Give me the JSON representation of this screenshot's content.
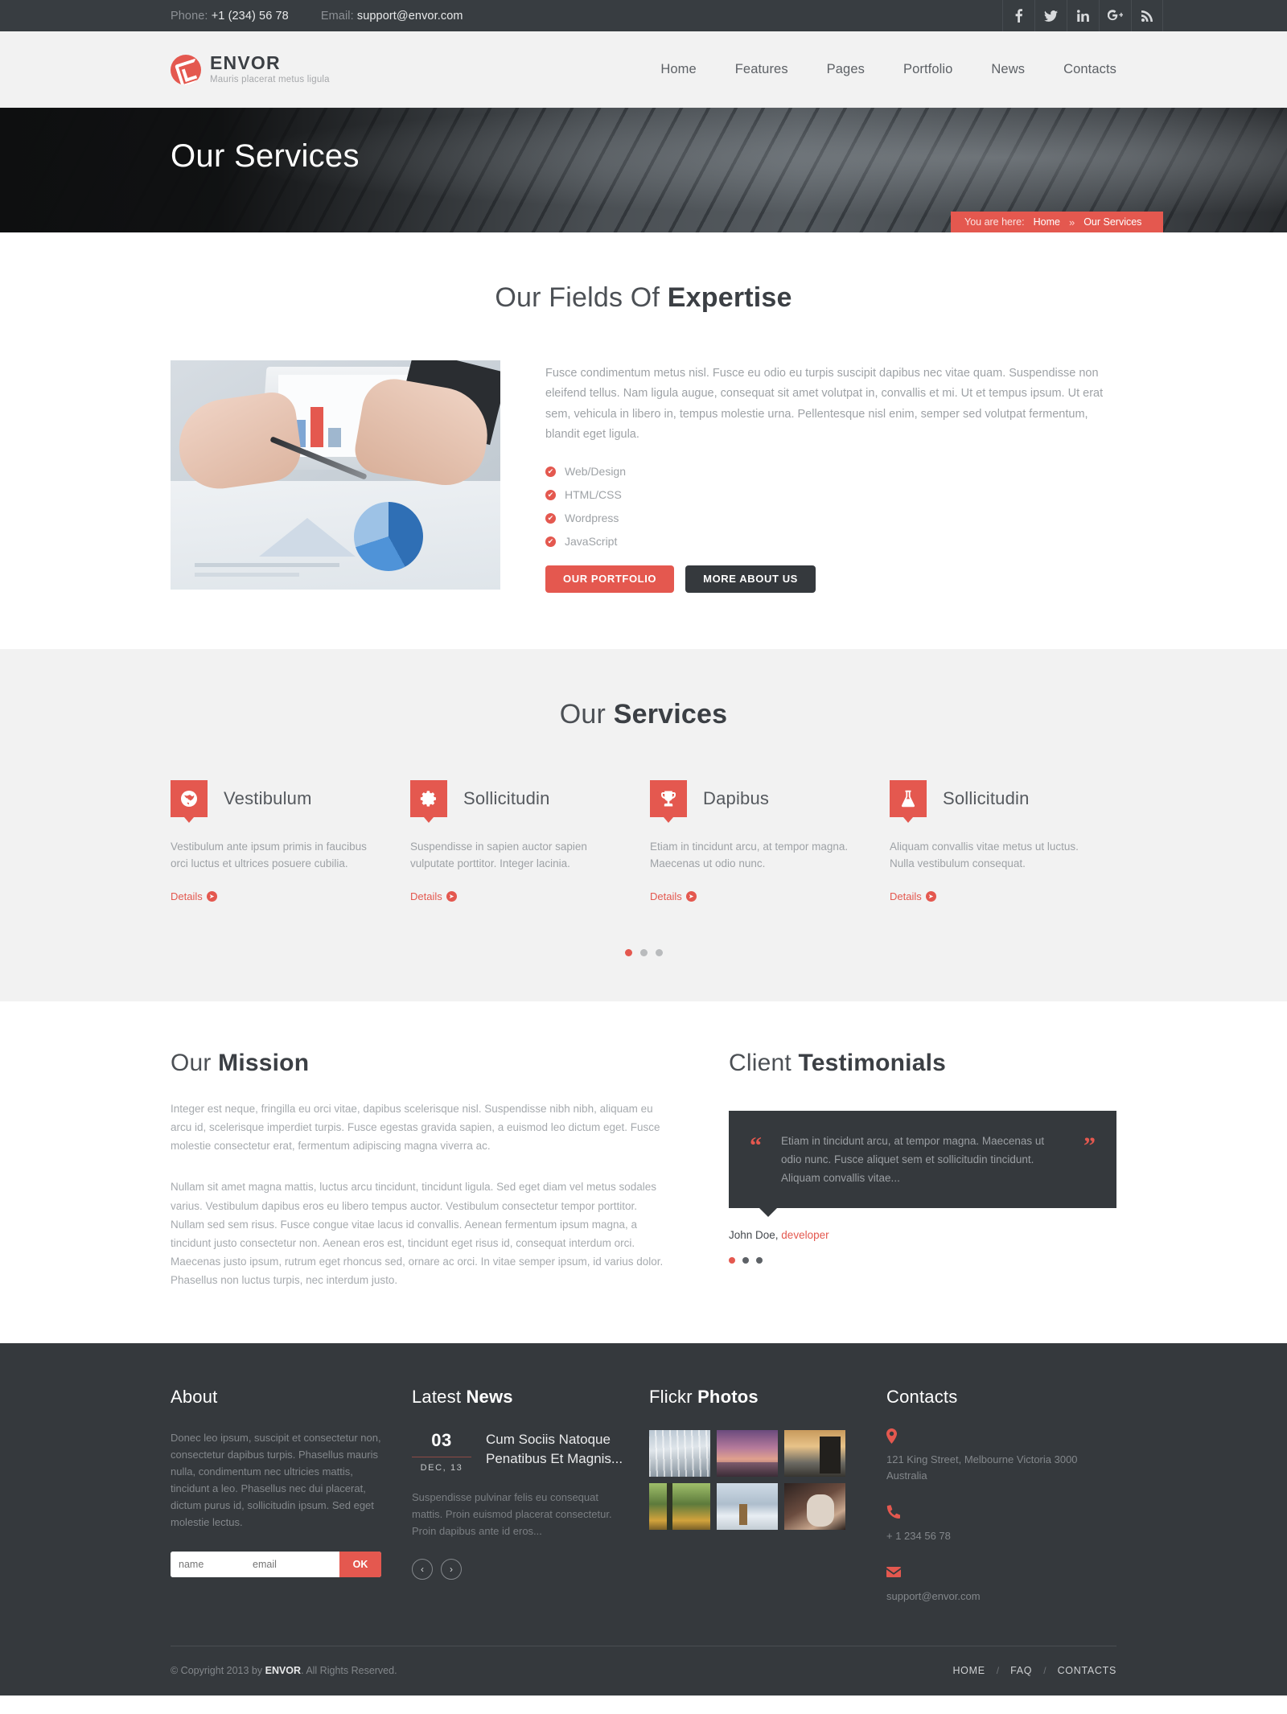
{
  "topbar": {
    "phone_label": "Phone:",
    "phone_value": "+1 (234) 56 78",
    "email_label": "Email:",
    "email_value": "support@envor.com",
    "social": [
      {
        "name": "facebook-icon",
        "glyph": "f"
      },
      {
        "name": "twitter-icon",
        "glyph": "t"
      },
      {
        "name": "linkedin-icon",
        "glyph": "in"
      },
      {
        "name": "google-plus-icon",
        "glyph": "g+"
      },
      {
        "name": "rss-icon",
        "glyph": "rss"
      }
    ]
  },
  "header": {
    "logo_name": "ENVOR",
    "logo_tagline": "Mauris placerat metus ligula",
    "nav": [
      {
        "label": "Home"
      },
      {
        "label": "Features"
      },
      {
        "label": "Pages"
      },
      {
        "label": "Portfolio"
      },
      {
        "label": "News"
      },
      {
        "label": "Contacts"
      }
    ]
  },
  "hero": {
    "title": "Our Services",
    "breadcrumb_label": "You are here:",
    "breadcrumb_home": "Home",
    "breadcrumb_sep": "»",
    "breadcrumb_current": "Our Services"
  },
  "expertise": {
    "title_light": "Our Fields Of ",
    "title_bold": "Expertise",
    "paragraph": "Fusce condimentum metus nisl. Fusce eu odio eu turpis suscipit dapibus nec vitae quam. Suspendisse non eleifend tellus. Nam ligula augue, consequat sit amet volutpat in, convallis et mi. Ut et tempus ipsum. Ut erat sem, vehicula in libero in, tempus molestie urna. Pellentesque nisl enim, semper sed volutpat fermentum, blandit eget ligula.",
    "list": [
      {
        "label": "Web/Design"
      },
      {
        "label": "HTML/CSS"
      },
      {
        "label": "Wordpress"
      },
      {
        "label": "JavaScript"
      }
    ],
    "btn_portfolio": "OUR PORTFOLIO",
    "btn_about": "MORE ABOUT US"
  },
  "services": {
    "title_light": "Our ",
    "title_bold": "Services",
    "details_label": "Details",
    "items": [
      {
        "icon": "globe-icon",
        "name": "Vestibulum",
        "text": "Vestibulum ante ipsum primis in faucibus orci luctus et ultrices posuere cubilia."
      },
      {
        "icon": "gear-icon",
        "name": "Sollicitudin",
        "text": "Suspendisse in sapien auctor sapien vulputate porttitor. Integer lacinia."
      },
      {
        "icon": "trophy-icon",
        "name": "Dapibus",
        "text": "Etiam in tincidunt arcu, at tempor magna. Maecenas ut odio nunc."
      },
      {
        "icon": "flask-icon",
        "name": "Sollicitudin",
        "text": "Aliquam convallis vitae metus ut luctus. Nulla vestibulum consequat."
      }
    ],
    "pager": [
      true,
      false,
      false
    ]
  },
  "mission": {
    "title_light": "Our ",
    "title_bold": "Mission",
    "paragraph1": "Integer est neque, fringilla eu orci vitae, dapibus scelerisque nisl. Suspendisse nibh nibh, aliquam eu arcu id, scelerisque imperdiet turpis. Fusce egestas gravida sapien, a euismod leo dictum eget. Fusce molestie consectetur erat, fermentum adipiscing magna viverra ac.",
    "paragraph2": "Nullam sit amet magna mattis, luctus arcu tincidunt, tincidunt ligula. Sed eget diam vel metus sodales varius. Vestibulum dapibus eros eu libero tempus auctor. Vestibulum consectetur tempor porttitor. Nullam sed sem risus. Fusce congue vitae lacus id convallis. Aenean fermentum ipsum magna, a tincidunt justo consectetur non. Aenean eros est, tincidunt eget risus id, consequat interdum orci. Maecenas justo ipsum, rutrum eget rhoncus sed, ornare ac orci. In vitae semper ipsum, id varius dolor. Phasellus non luctus turpis, nec interdum justo."
  },
  "testimonials": {
    "title_light": "Client ",
    "title_bold": "Testimonials",
    "quote_open": "“",
    "quote_close": "”",
    "quote": "Etiam in tincidunt arcu, at tempor magna. Maecenas ut odio nunc. Fusce aliquet sem et sollicitudin tincidunt. Aliquam convallis vitae...",
    "author_name": "John Doe, ",
    "author_role": "developer"
  },
  "footer": {
    "about": {
      "title": "About",
      "text": "Donec leo ipsum, suscipit et consectetur non, consectetur dapibus turpis. Phasellus mauris nulla, condimentum nec ultricies mattis, tincidunt a leo. Phasellus nec dui placerat, dictum purus id, sollicitudin ipsum. Sed eget molestie lectus.",
      "name_placeholder": "name",
      "email_placeholder": "email",
      "ok_label": "OK"
    },
    "news": {
      "title_light": "Latest ",
      "title_bold": "News",
      "day": "03",
      "month": "DEC, 13",
      "headline": "Cum Sociis Natoque Penatibus Et Magnis...",
      "text": "Suspendisse pulvinar felis eu consequat mattis. Proin euismod placerat consectetur. Proin dapibus ante id eros...",
      "prev": "‹",
      "next": "›"
    },
    "flickr": {
      "title_light": "Flickr ",
      "title_bold": "Photos",
      "photos": [
        "a",
        "b",
        "c",
        "d",
        "e",
        "f"
      ]
    },
    "contacts": {
      "title": "Contacts",
      "address": "121 King Street, Melbourne  Victoria 3000 Australia",
      "phone": "+ 1 234 56 78",
      "email": "support@envor.com"
    },
    "copyright_prefix": "© Copyright 2013 by ",
    "copyright_brand": "ENVOR",
    "copyright_suffix": ". All Rights Reserved.",
    "bottom_links": [
      {
        "label": "HOME"
      },
      {
        "label": "FAQ"
      },
      {
        "label": "CONTACTS"
      }
    ],
    "link_sep": "/"
  },
  "colors": {
    "accent": "#e4584f",
    "dark": "#35393d",
    "topbar": "#383d41",
    "light_bg": "#f2f2f2"
  }
}
